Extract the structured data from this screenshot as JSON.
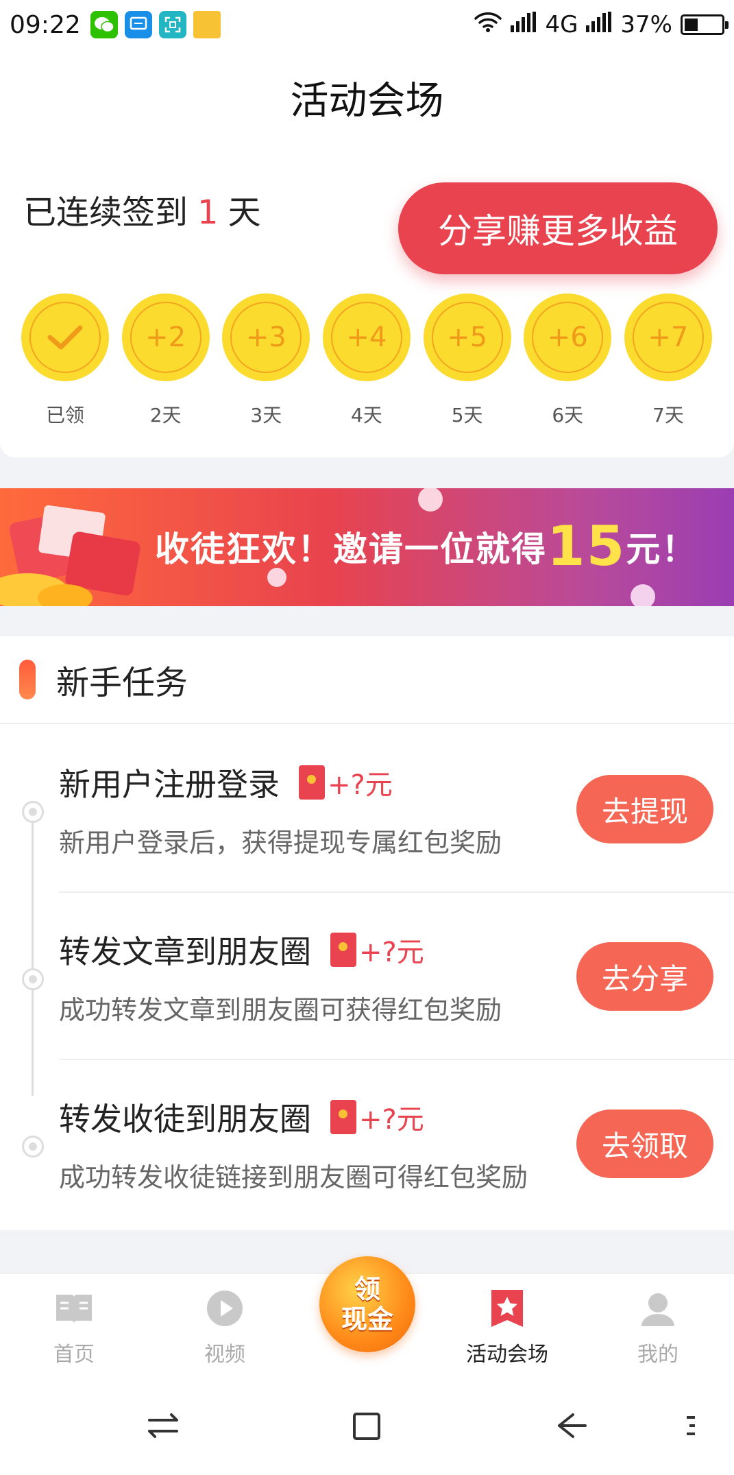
{
  "status_bar": {
    "time": "09:22",
    "network": "4G",
    "battery": "37%",
    "battery_level": 0.37,
    "notification_icons": [
      "wechat-icon",
      "message-icon",
      "scan-icon",
      "folder-icon"
    ]
  },
  "page": {
    "title": "活动会场"
  },
  "signin": {
    "streak_prefix": "已连续签到",
    "streak_count": "1",
    "streak_suffix": "天",
    "share_button": "分享赚更多收益",
    "days": [
      {
        "value": "",
        "label": "已领",
        "claimed": true
      },
      {
        "value": "+2",
        "label": "2天"
      },
      {
        "value": "+3",
        "label": "3天"
      },
      {
        "value": "+4",
        "label": "4天"
      },
      {
        "value": "+5",
        "label": "5天"
      },
      {
        "value": "+6",
        "label": "6天"
      },
      {
        "value": "+7",
        "label": "7天"
      }
    ]
  },
  "banner": {
    "text_before": "收徒狂欢！邀请一位就得",
    "amount": "15",
    "text_after": "元！"
  },
  "tasks": {
    "header": "新手任务",
    "items": [
      {
        "title": "新用户注册登录",
        "reward": "+?元",
        "desc": "新用户登录后，获得提现专属红包奖励",
        "button": "去提现"
      },
      {
        "title": "转发文章到朋友圈",
        "reward": "+?元",
        "desc": "成功转发文章到朋友圈可获得红包奖励",
        "button": "去分享"
      },
      {
        "title": "转发收徒到朋友圈",
        "reward": "+?元",
        "desc": "成功转发收徒链接到朋友圈可得红包奖励",
        "button": "去领取"
      }
    ]
  },
  "tabbar": {
    "items": [
      {
        "label": "首页",
        "icon": "book-icon"
      },
      {
        "label": "视频",
        "icon": "play-icon"
      },
      {
        "label": "活动会场",
        "icon": "star-ribbon-icon",
        "active": true
      },
      {
        "label": "我的",
        "icon": "user-icon"
      }
    ],
    "center_button": {
      "line1": "领",
      "line2": "现金"
    }
  },
  "colors": {
    "accent": "#e8434e",
    "button": "#f56654",
    "coin": "#fcdb2f",
    "coin_text": "#f09a1a"
  }
}
